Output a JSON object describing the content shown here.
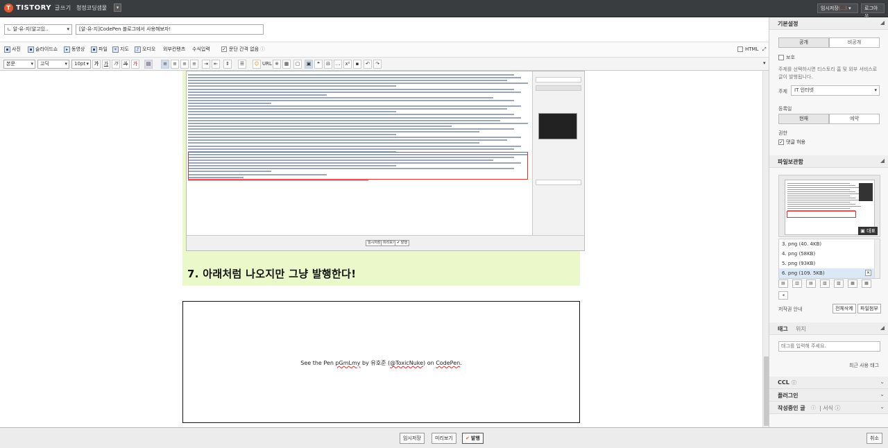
{
  "topbar": {
    "logo_text": "TISTORY",
    "logo_sub": "글쓰기",
    "blog_name": "청정코딩샘물",
    "temp_save_label": "임시저장",
    "temp_save_count": "(...)",
    "logout_label": "로그아웃"
  },
  "post": {
    "category": "ㄴ 알-유-지(알고있..",
    "title": "[알-유-지]CodePen 블로그에서 사용해보자!"
  },
  "insert_toolbar": {
    "items": [
      "사진",
      "슬라이드쇼",
      "동영상",
      "파일",
      "지도",
      "오디오",
      "외부컨텐츠",
      "수식입력"
    ],
    "paragraph_option": "문단 간격 없음",
    "html_label": "HTML"
  },
  "format_toolbar": {
    "block_format": "본문",
    "font": "고딕",
    "size": "10pt",
    "url_label": "URL"
  },
  "content": {
    "heading": "7. 아래처럼 나오지만 그냥 발행한다!",
    "embed_text": {
      "prefix": "See the Pen ",
      "pen_id": "pGmLmy",
      "by": " by 유호준 (",
      "user": "@ToxicNuke",
      "on": ") on ",
      "site": "CodePen",
      "suffix": "."
    },
    "screenshot_buttons": [
      "임시저장",
      "미리보기",
      "✔ 발행"
    ]
  },
  "sidebar": {
    "basic_settings": "기본설정",
    "visibility": [
      "공개",
      "비공개"
    ],
    "protect_label": "보호",
    "protect_desc": "주제를 선택하시면 티스토리 홈 및 외부 서비스로 글이 발행됩니다.",
    "topic_label": "주제",
    "topic_value": "IT 인터넷",
    "register_label": "등록일",
    "register_options": [
      "현재",
      "예약"
    ],
    "permission_label": "권한",
    "allow_comments": "댓글 허용",
    "file_storage": "파일보관함",
    "daepyo": "대표",
    "files": [
      "3. png (40. 4KB)",
      "4. png (58KB)",
      "5. png (93KB)",
      "6. png (109. 5KB)"
    ],
    "copyright_label": "저작권 안내",
    "delete_all": "전체삭제",
    "file_upload": "파일첨부",
    "tabs": [
      "태그",
      "위치"
    ],
    "tag_placeholder": "태그를 입력해 주세요.",
    "recent_tags": "최근 사용 태그",
    "ccl": "CCL",
    "plugin": "플러그인",
    "writing": "작성중인 글",
    "style": "서식"
  },
  "bottombar": {
    "temp_save": "임시저장",
    "preview": "미리보기",
    "publish": "발행",
    "cancel": "취소"
  }
}
